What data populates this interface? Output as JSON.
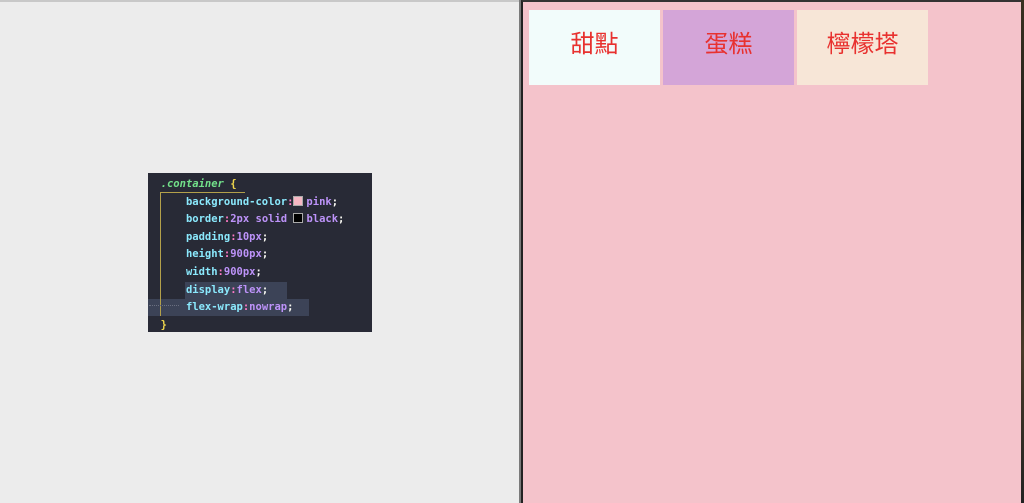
{
  "code": {
    "selector": ".container",
    "open_brace": "{",
    "close_brace": "}",
    "declarations": [
      {
        "property": "background-color",
        "value": "pink",
        "swatch": "#f6b7c3"
      },
      {
        "property": "border",
        "value": "2px solid black",
        "num": "2px",
        "rest": " solid ",
        "swatch": "#000000",
        "color_word": "black"
      },
      {
        "property": "padding",
        "value": "10px"
      },
      {
        "property": "height",
        "value": "900px"
      },
      {
        "property": "width",
        "value": "900px"
      },
      {
        "property": "display",
        "value": "flex"
      },
      {
        "property": "flex-wrap",
        "value": "nowrap"
      }
    ]
  },
  "preview": {
    "background": "#f4c3cb",
    "items": [
      {
        "label": "甜點",
        "color": "#f2fcfb"
      },
      {
        "label": "蛋糕",
        "color": "#d4a5d8"
      },
      {
        "label": "檸檬塔",
        "color": "#f7e6d7"
      }
    ]
  }
}
